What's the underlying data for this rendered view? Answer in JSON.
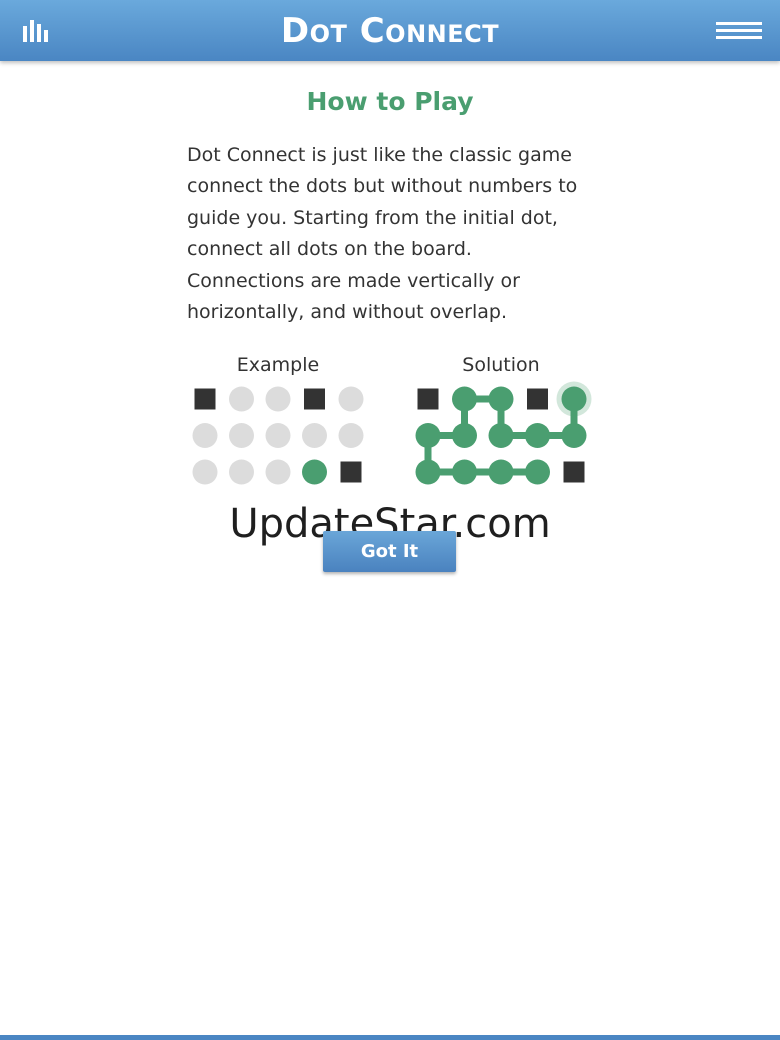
{
  "header": {
    "title": "Dot Connect",
    "stats_icon": "bar-chart-icon",
    "menu_icon": "hamburger-menu-icon"
  },
  "how_to_play": {
    "title": "How to Play",
    "text": "Dot Connect is just like the classic game connect the dots but without numbers to guide you. Starting from the initial dot, connect all dots on the board. Connections are made vertically or horizontally, and without overlap."
  },
  "example": {
    "label": "Example",
    "rows": [
      [
        "square",
        "dot",
        "dot",
        "square",
        "dot"
      ],
      [
        "dot",
        "dot",
        "dot",
        "dot",
        "dot"
      ],
      [
        "dot",
        "dot",
        "dot",
        "start",
        "square"
      ]
    ]
  },
  "solution": {
    "label": "Solution",
    "rows": [
      [
        "square",
        "active",
        "active",
        "square",
        "active"
      ],
      [
        "active",
        "active",
        "active",
        "active",
        "active"
      ],
      [
        "active",
        "active",
        "active",
        "active",
        "square"
      ]
    ],
    "path": [
      [
        0,
        4
      ],
      [
        1,
        4
      ],
      [
        1,
        3
      ],
      [
        1,
        2
      ],
      [
        0,
        2
      ],
      [
        0,
        1
      ],
      [
        1,
        1
      ],
      [
        1,
        0
      ],
      [
        2,
        0
      ],
      [
        2,
        1
      ],
      [
        2,
        2
      ],
      [
        2,
        3
      ]
    ],
    "highlight": [
      0,
      4
    ]
  },
  "button": {
    "label": "Got It"
  },
  "watermark": "UpdateStar.com",
  "colors": {
    "header": "#5a98d0",
    "green": "#4a9e70",
    "dot_gray": "#dcdcdc",
    "square": "#333333"
  }
}
